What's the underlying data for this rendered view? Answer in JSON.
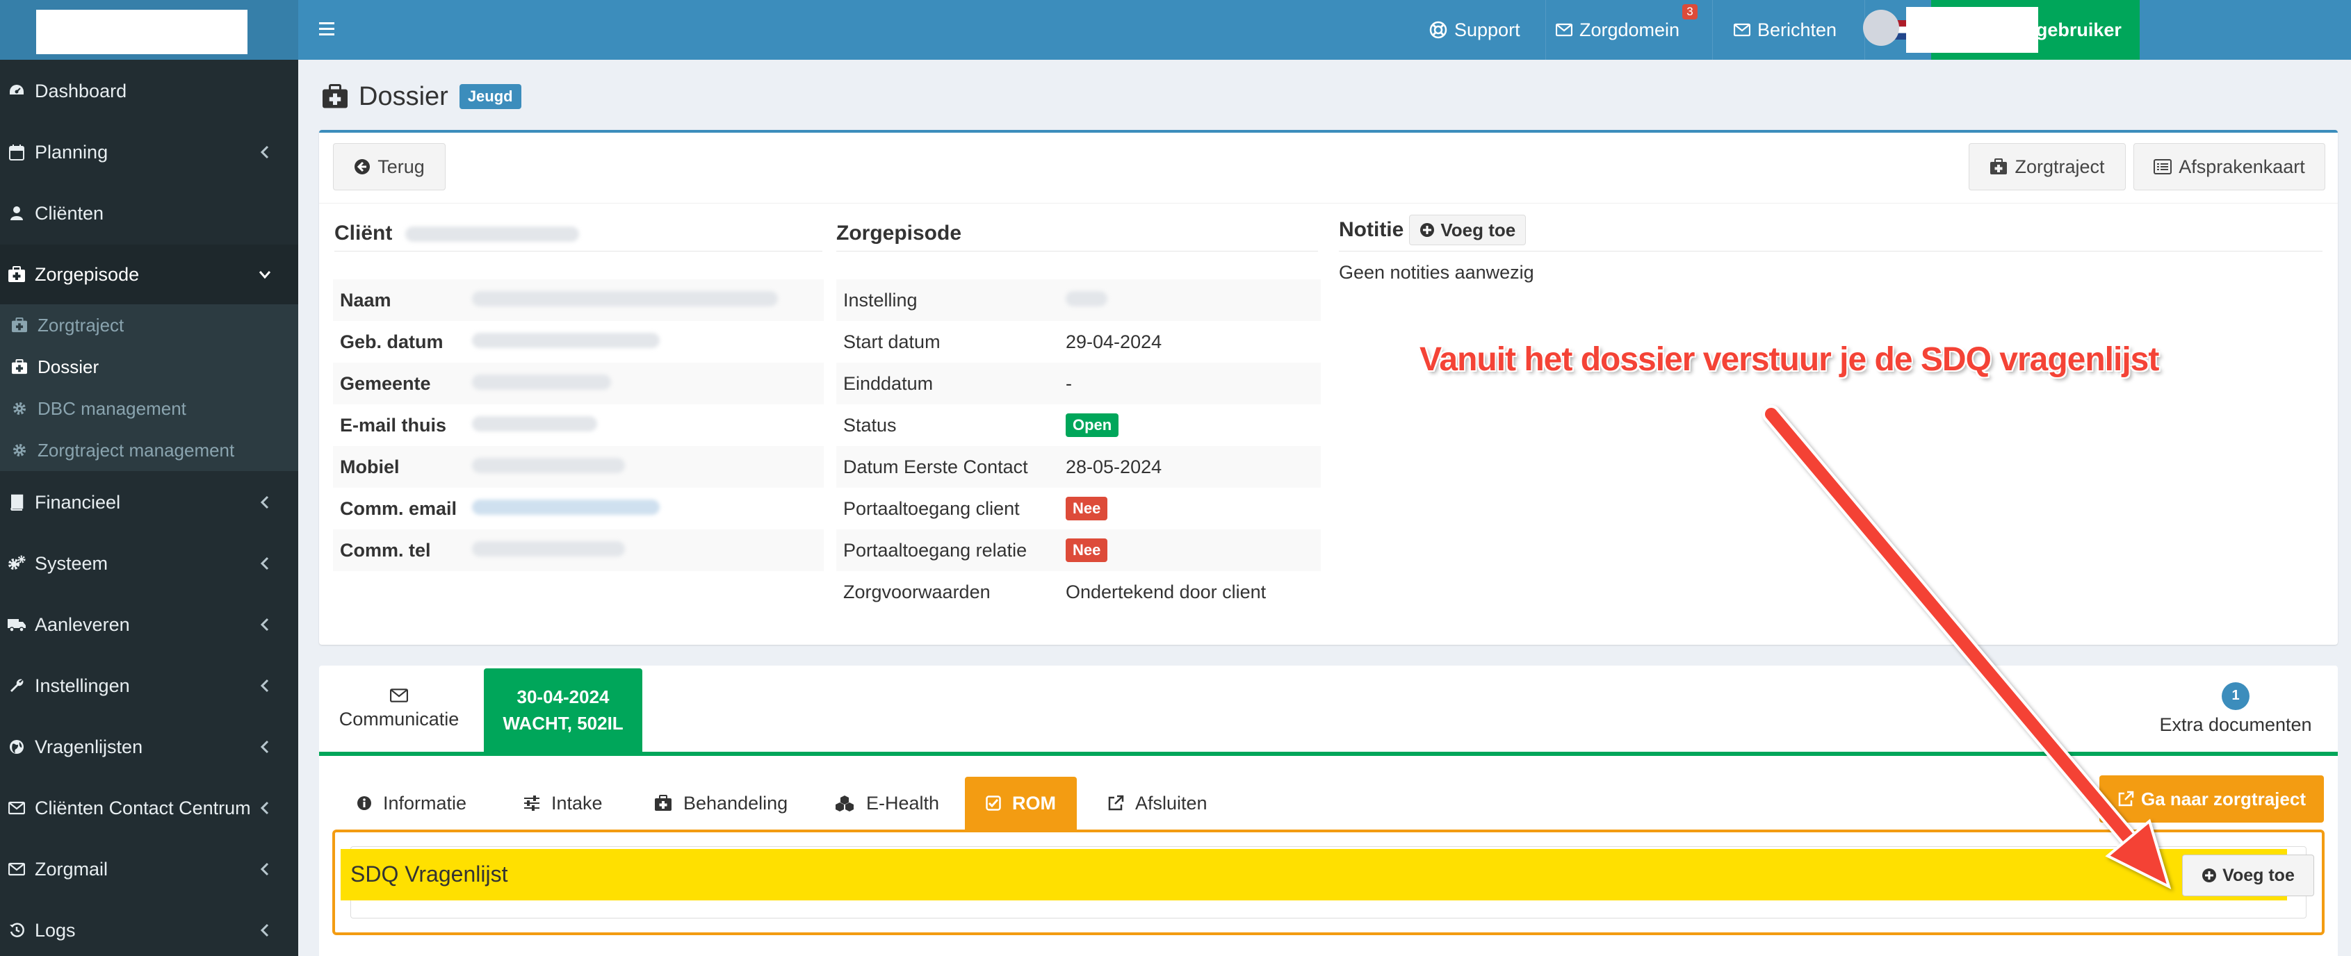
{
  "sidebar": {
    "items": [
      {
        "label": "Dashboard",
        "icon": "dashboard-icon"
      },
      {
        "label": "Planning",
        "icon": "calendar-icon"
      },
      {
        "label": "Cliënten",
        "icon": "user-icon"
      },
      {
        "label": "Zorgepisode",
        "icon": "medkit-icon"
      },
      {
        "label": "Financieel",
        "icon": "book-icon"
      },
      {
        "label": "Systeem",
        "icon": "cogs-icon"
      },
      {
        "label": "Aanleveren",
        "icon": "truck-icon"
      },
      {
        "label": "Instellingen",
        "icon": "wrench-icon"
      },
      {
        "label": "Vragenlijsten",
        "icon": "globe-icon"
      },
      {
        "label": "Cliënten Contact Centrum",
        "icon": "envelope-icon"
      },
      {
        "label": "Zorgmail",
        "icon": "envelope-icon"
      },
      {
        "label": "Logs",
        "icon": "history-icon"
      }
    ],
    "submenu": [
      {
        "label": "Zorgtraject",
        "icon": "medkit-icon"
      },
      {
        "label": "Dossier",
        "icon": "medkit-icon"
      },
      {
        "label": "DBC management",
        "icon": "gear-icon"
      },
      {
        "label": "Zorgtraject management",
        "icon": "gear-icon"
      }
    ]
  },
  "topbar": {
    "support": "Support",
    "zorgdomein": "Zorgdomein",
    "zorgdomein_count": "3",
    "berichten": "Berichten",
    "switch_user": "Wissel gebruiker"
  },
  "page": {
    "title": "Dossier",
    "badge": "Jeugd"
  },
  "toolbar": {
    "back": "Terug",
    "zorgtraject": "Zorgtraject",
    "afsprakenkaart": "Afsprakenkaart"
  },
  "client": {
    "title": "Cliënt",
    "rows": [
      "Naam",
      "Geb. datum",
      "Gemeente",
      "E-mail thuis",
      "Mobiel",
      "Comm. email",
      "Comm. tel"
    ]
  },
  "episode": {
    "title": "Zorgepisode",
    "instelling_label": "Instelling",
    "start_label": "Start datum",
    "start_value": "29-04-2024",
    "eind_label": "Einddatum",
    "eind_value": "-",
    "status_label": "Status",
    "status_value": "Open",
    "eerste_label": "Datum Eerste Contact",
    "eerste_value": "28-05-2024",
    "portaal_client_label": "Portaaltoegang client",
    "portaal_client_value": "Nee",
    "portaal_relatie_label": "Portaaltoegang relatie",
    "portaal_relatie_value": "Nee",
    "voorwaarden_label": "Zorgvoorwaarden",
    "voorwaarden_value": "Ondertekend door client"
  },
  "notes": {
    "title": "Notitie",
    "add": "Voeg toe",
    "empty": "Geen notities aanwezig"
  },
  "tabs": {
    "communicatie": "Communicatie",
    "date_line1": "30-04-2024",
    "date_line2": "WACHT, 502IL",
    "extra_count": "1",
    "extra": "Extra documenten"
  },
  "subtabs": {
    "informatie": "Informatie",
    "intake": "Intake",
    "behandeling": "Behandeling",
    "ehealth": "E-Health",
    "rom": "ROM",
    "afsluiten": "Afsluiten",
    "goto": "Ga naar zorgtraject"
  },
  "rom": {
    "title": "SDQ Vragenlijst",
    "add": "Voeg toe"
  },
  "annotation": {
    "text": "Vanuit het dossier verstuur je de SDQ vragenlijst",
    "color": "#f44336"
  },
  "colors": {
    "primary": "#3c8dbc",
    "success": "#00a65a",
    "warning": "#f39c12",
    "danger": "#dd4b39",
    "highlight": "#ffe000"
  }
}
